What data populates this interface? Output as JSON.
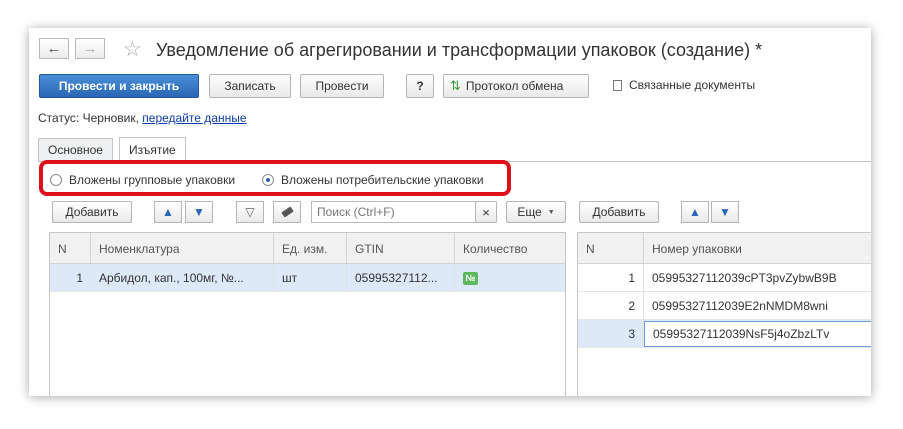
{
  "window": {
    "title": "Уведомление об агрегировании и трансформации упаковок (создание) *",
    "nav_back": "←",
    "nav_forward": "→",
    "star": "☆"
  },
  "toolbar": {
    "post_close": "Провести и закрыть",
    "save": "Записать",
    "post": "Провести",
    "help": "?",
    "exchange_log": "Протокол обмена",
    "related_docs": "Связанные документы"
  },
  "status": {
    "label": "Статус:",
    "value": "Черновик,",
    "link": "передайте данные"
  },
  "tabs": [
    {
      "label": "Основное"
    },
    {
      "label": "Изъятие"
    }
  ],
  "radio": {
    "group": "Вложены групповые упаковки",
    "consumer": "Вложены потребительские упаковки",
    "selected": "consumer"
  },
  "left_panel": {
    "add": "Добавить",
    "search_placeholder": "Поиск (Ctrl+F)",
    "clear": "×",
    "more": "Еще",
    "columns": [
      "N",
      "Номенклатура",
      "Ед. изм.",
      "GTIN",
      "Количество"
    ],
    "rows": [
      {
        "n": "1",
        "name": "Арбидол, кап., 100мг, №...",
        "unit": "шт",
        "gtin": "05995327112...",
        "qty_badge": "№"
      }
    ]
  },
  "right_panel": {
    "add": "Добавить",
    "columns": [
      "N",
      "Номер упаковки"
    ],
    "rows": [
      {
        "n": "1",
        "code": "05995327112039cPT3pvZybwB9B"
      },
      {
        "n": "2",
        "code": "05995327112039E2nNMDM8wni"
      },
      {
        "n": "3",
        "code": "05995327112039NsF5j4oZbzLTv"
      }
    ]
  },
  "colors": {
    "accent": "#2a66b5",
    "highlight_border": "#e0101a",
    "selected_row": "#dde9f7",
    "badge": "#5cb85c"
  }
}
